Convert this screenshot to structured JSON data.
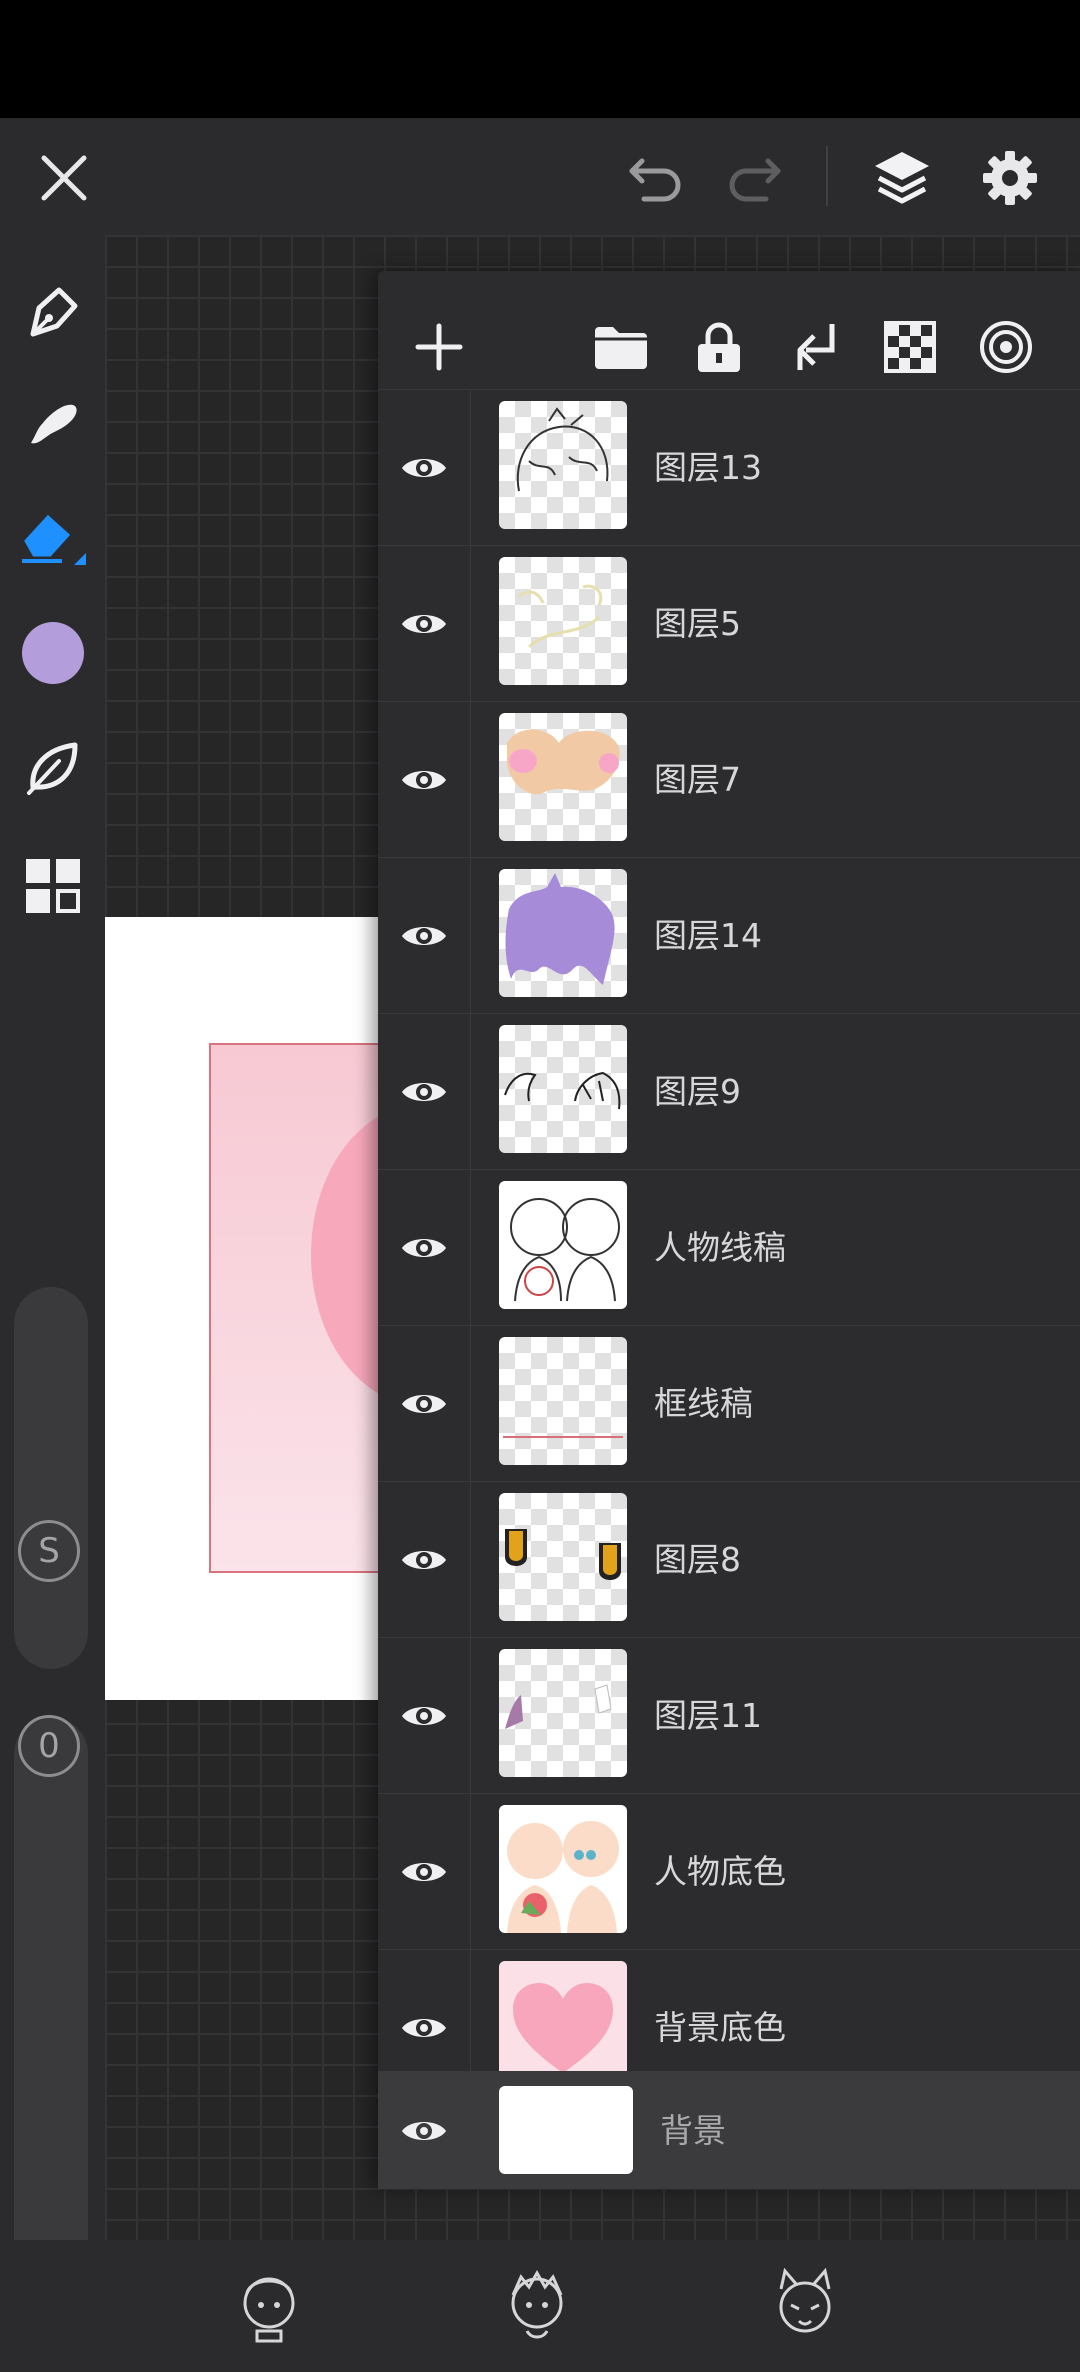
{
  "colors": {
    "accent": "#1e90ff",
    "current_color": "#b39ddb"
  },
  "toolbar": {
    "close_icon": "close-icon",
    "undo_icon": "undo-icon",
    "redo_icon": "redo-icon",
    "layers_icon": "layers-icon",
    "settings_icon": "gear-icon"
  },
  "sidebar": {
    "tools": [
      "pen-icon",
      "smudge-icon",
      "eraser-icon",
      "color-swatch",
      "leaf-icon",
      "grid-icon"
    ],
    "size_label": "S",
    "opacity_label": "0"
  },
  "layers_panel": {
    "tools": [
      "add-icon",
      "folder-icon",
      "lock-icon",
      "merge-down-icon",
      "transparency-icon",
      "target-icon"
    ],
    "layers": [
      {
        "name": "图层13",
        "visible": true
      },
      {
        "name": "图层5",
        "visible": true
      },
      {
        "name": "图层7",
        "visible": true
      },
      {
        "name": "图层14",
        "visible": true
      },
      {
        "name": "图层9",
        "visible": true
      },
      {
        "name": "人物线稿",
        "visible": true
      },
      {
        "name": "框线稿",
        "visible": true
      },
      {
        "name": "图层8",
        "visible": true
      },
      {
        "name": "图层11",
        "visible": true
      },
      {
        "name": "人物底色",
        "visible": true
      },
      {
        "name": "背景底色",
        "visible": true
      },
      {
        "name": "背景",
        "visible": true
      }
    ]
  },
  "bottom_bar": {
    "avatars": [
      "avatar-1",
      "avatar-2",
      "avatar-3"
    ]
  }
}
